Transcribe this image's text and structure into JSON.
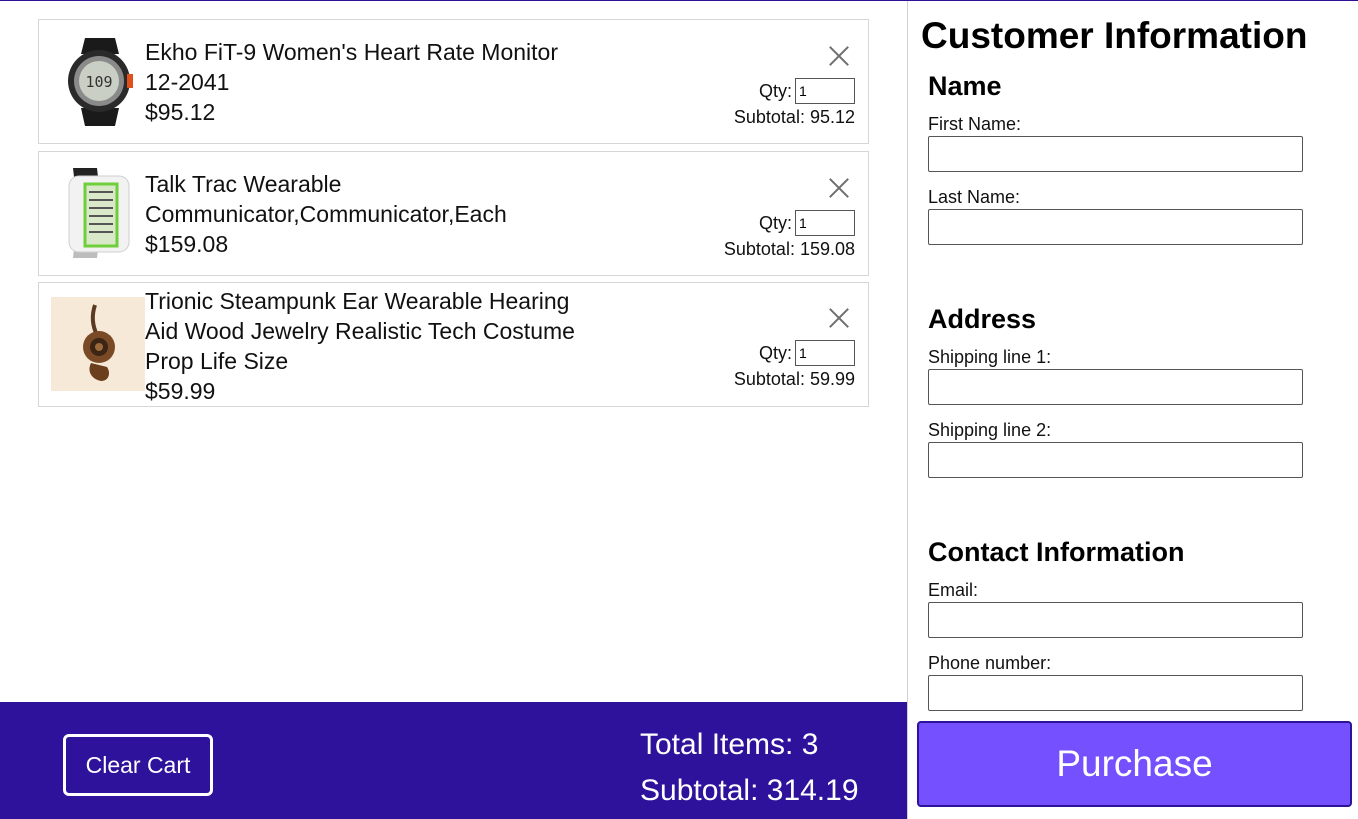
{
  "cart": {
    "items": [
      {
        "name": "Ekho FiT-9 Women's Heart Rate Monitor 12-2041",
        "price": "$95.12",
        "qty_label": "Qty:",
        "qty": "1",
        "subtotal": "Subtotal: 95.12",
        "thumb_icon": "heart-rate-watch-icon"
      },
      {
        "name": "Talk Trac Wearable Communicator,Communicator,Each",
        "price": "$159.08",
        "qty_label": "Qty:",
        "qty": "1",
        "subtotal": "Subtotal: 159.08",
        "thumb_icon": "wearable-communicator-icon"
      },
      {
        "name": "Trionic Steampunk Ear Wearable Hearing Aid Wood Jewelry Realistic Tech Costume Prop Life Size",
        "price": "$59.99",
        "qty_label": "Qty:",
        "qty": "1",
        "subtotal": "Subtotal: 59.99",
        "thumb_icon": "steampunk-ear-piece-icon"
      }
    ]
  },
  "footer": {
    "clear_label": "Clear Cart",
    "total_items": "Total Items: 3",
    "subtotal": "Subtotal: 314.19"
  },
  "customer": {
    "title": "Customer Information",
    "name_section": "Name",
    "first_name_label": "First Name:",
    "first_name_value": "",
    "last_name_label": "Last Name:",
    "last_name_value": "",
    "address_section": "Address",
    "shipping1_label": "Shipping line 1:",
    "shipping1_value": "",
    "shipping2_label": "Shipping line 2:",
    "shipping2_value": "",
    "contact_section": "Contact Information",
    "email_label": "Email:",
    "email_value": "",
    "phone_label": "Phone number:",
    "phone_value": "",
    "purchase_label": "Purchase"
  },
  "colors": {
    "footer_bg": "#2e129c",
    "purchase_bg": "#7550ff",
    "border": "#d6d6d6"
  }
}
